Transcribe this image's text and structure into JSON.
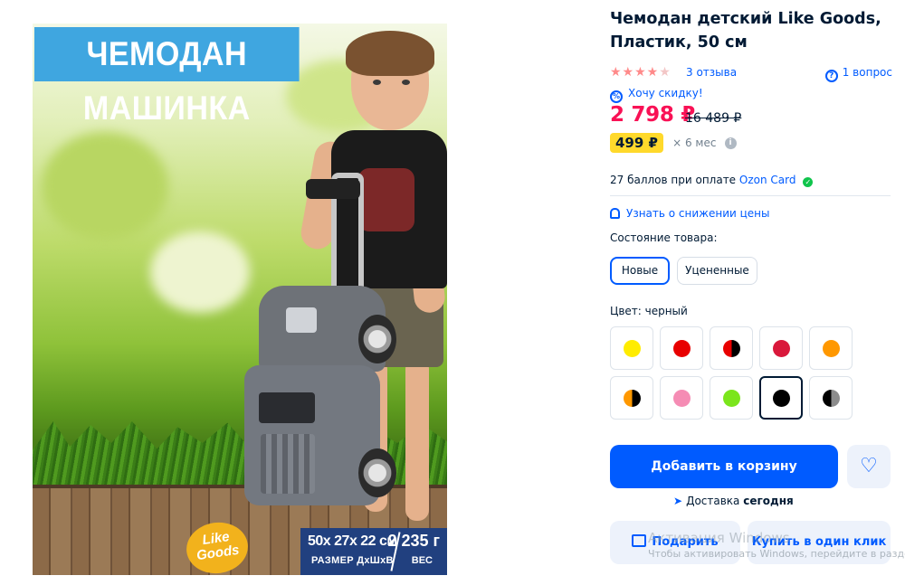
{
  "photo": {
    "banner_text": "ЧЕМОДАН МАШИНКА",
    "logo_text": "Like Goods",
    "dimensions_value": "50x 27x 22 см",
    "dimensions_label": "РАЗМЕР ДхШхВ",
    "weight_value": "2 235 г",
    "weight_label": "ВЕС"
  },
  "product": {
    "title": "Чемодан детский Like Goods, Пластик, 50 см",
    "rating_stars": "★★★★",
    "rating_half": "★",
    "rating": 4.5,
    "reviews_label": "3 отзыва",
    "questions_label": "1 вопрос",
    "discount_wish_label": "Хочу скидку!",
    "price": "2 798 ₽",
    "old_price": "16 489 ₽",
    "installment_amount": "499 ₽",
    "installment_term": "× 6 мес",
    "points_text": "27 баллов при оплате",
    "points_card": "Ozon Card",
    "price_watch_label": "Узнать о снижении цены"
  },
  "condition": {
    "label": "Состояние товара:",
    "options": [
      "Новые",
      "Уцененные"
    ],
    "selected": "Новые"
  },
  "color": {
    "label": "Цвет: черный",
    "swatches": [
      {
        "name": "yellow",
        "color": "#ffec00"
      },
      {
        "name": "red",
        "color": "#e80000"
      },
      {
        "name": "red-black",
        "color": "#e80000",
        "color2": "#000000"
      },
      {
        "name": "crimson",
        "color": "#d9183b"
      },
      {
        "name": "orange",
        "color": "#ff9800"
      },
      {
        "name": "orange-black",
        "color": "#ff9800",
        "color2": "#000000"
      },
      {
        "name": "pink",
        "color": "#f58cb4"
      },
      {
        "name": "lime",
        "color": "#7be51c"
      },
      {
        "name": "black",
        "color": "#000000"
      },
      {
        "name": "black-gray",
        "color": "#000000",
        "color2": "#8c8c8c"
      }
    ],
    "selected": "black"
  },
  "actions": {
    "add_to_cart": "Добавить в корзину",
    "favorite_icon": "heart-icon",
    "delivery_label": "Доставка",
    "delivery_when": "сегодня",
    "gift_label": "Подарить",
    "one_click_label": "Купить в один клик"
  },
  "os_watermark": {
    "title": "Активация Windows",
    "subtitle": "Чтобы активировать Windows, перейдите в раздел \""
  },
  "colors": {
    "accent": "#005bff",
    "price": "#f91155",
    "installment_bg": "#ffd92b"
  }
}
